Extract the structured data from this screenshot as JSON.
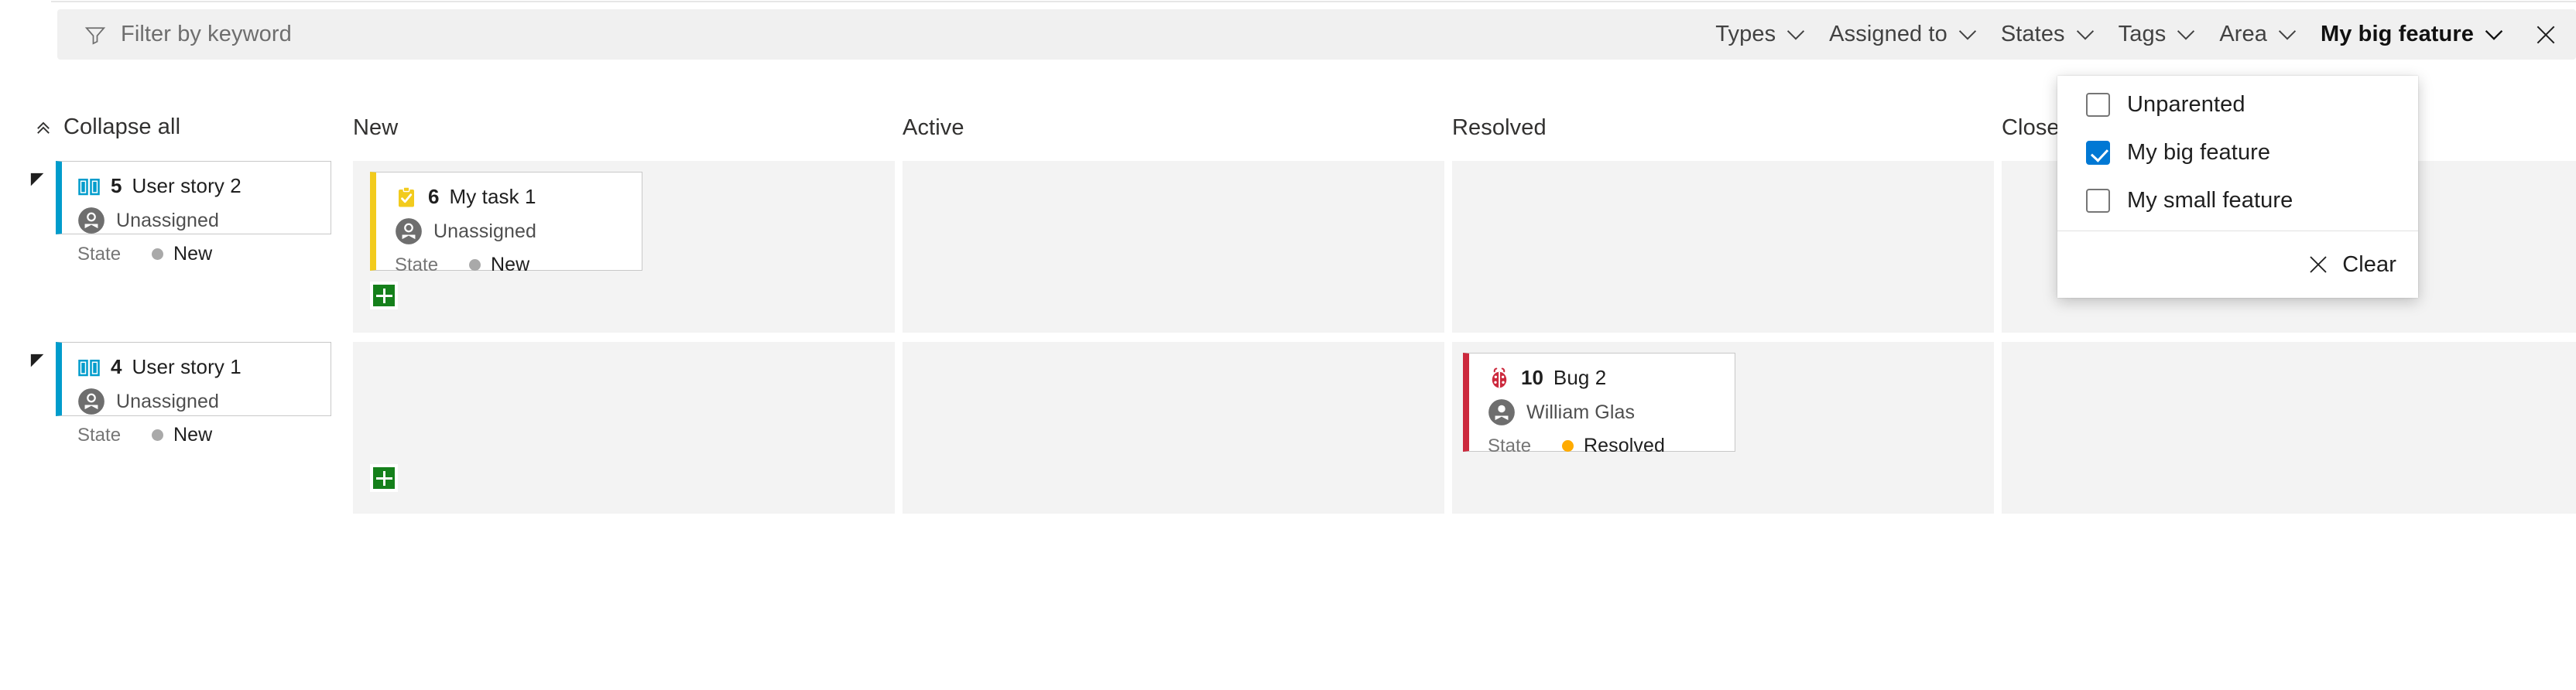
{
  "filter_bar": {
    "keyword": {
      "icon": "funnel-icon",
      "value": "",
      "placeholder": "Filter by keyword"
    },
    "pills": [
      {
        "label": "Types",
        "active": false
      },
      {
        "label": "Assigned to",
        "active": false
      },
      {
        "label": "States",
        "active": false
      },
      {
        "label": "Tags",
        "active": false
      },
      {
        "label": "Area",
        "active": false
      },
      {
        "label": "My big feature",
        "active": true
      }
    ],
    "close_icon": "close-icon"
  },
  "dropdown": {
    "items": [
      {
        "label": "Unparented",
        "checked": false
      },
      {
        "label": "My big feature",
        "checked": true
      },
      {
        "label": "My small feature",
        "checked": false
      }
    ],
    "clear": {
      "label": "Clear",
      "icon": "close-icon"
    }
  },
  "board": {
    "collapse_all": {
      "label": "Collapse all",
      "icon": "chevron-double-up-icon"
    },
    "columns": [
      {
        "label": "New"
      },
      {
        "label": "Active"
      },
      {
        "label": "Resolved"
      },
      {
        "label": "Closed"
      }
    ],
    "lanes": [
      {
        "parent": {
          "icon": "user-story-icon",
          "id": "5",
          "title": "User story 2",
          "assigned_to": "Unassigned",
          "state_key": "State",
          "state_value": "New",
          "state_color": "#a9a9a9",
          "accent": "#009ccc"
        },
        "cells": [
          {
            "column": "New",
            "cards": [
              {
                "icon": "task-icon",
                "id": "6",
                "title": "My task 1",
                "assigned_to": "Unassigned",
                "state_key": "State",
                "state_value": "New",
                "state_color": "#a9a9a9",
                "accent": "#f2cb1d"
              }
            ],
            "add_button": true
          },
          {
            "column": "Active",
            "cards": [],
            "add_button": false
          },
          {
            "column": "Resolved",
            "cards": [],
            "add_button": false
          },
          {
            "column": "Closed",
            "cards": [],
            "add_button": false
          }
        ]
      },
      {
        "parent": {
          "icon": "user-story-icon",
          "id": "4",
          "title": "User story 1",
          "assigned_to": "Unassigned",
          "state_key": "State",
          "state_value": "New",
          "state_color": "#a9a9a9",
          "accent": "#009ccc"
        },
        "cells": [
          {
            "column": "New",
            "cards": [],
            "add_button": true
          },
          {
            "column": "Active",
            "cards": [],
            "add_button": false
          },
          {
            "column": "Resolved",
            "cards": [
              {
                "icon": "bug-icon",
                "id": "10",
                "title": "Bug 2",
                "assigned_to": "William Glas",
                "state_key": "State",
                "state_value": "Resolved",
                "state_color": "#ffab00",
                "accent": "#cc293d"
              }
            ],
            "add_button": false
          },
          {
            "column": "Closed",
            "cards": [],
            "add_button": false
          }
        ]
      }
    ]
  },
  "colors": {
    "accent_blue": "#0078d4",
    "user_story": "#009ccc",
    "task": "#f2cb1d",
    "bug": "#cc293d",
    "add_green": "#15801b",
    "state_new": "#a9a9a9",
    "state_resolved": "#ffab00"
  }
}
